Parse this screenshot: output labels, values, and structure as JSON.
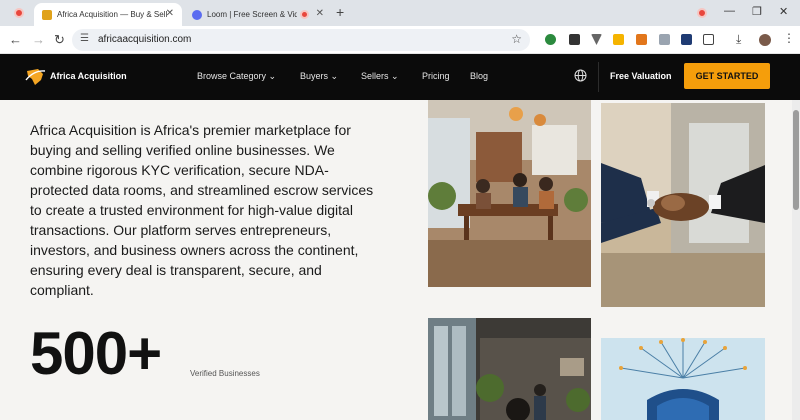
{
  "browser": {
    "tabs": [
      {
        "title": "Africa Acquisition — Buy & Sell",
        "active": true,
        "favicon_color": "#e0a21a"
      },
      {
        "title": "Loom | Free Screen & Video",
        "active": false,
        "favicon_color": "#5b6cf0"
      }
    ],
    "url": "africaacquisition.com",
    "icons": [
      "back-icon",
      "forward-icon",
      "reload-icon",
      "site-info-icon",
      "bookmark-star-icon",
      "download-icon",
      "profile-avatar",
      "menu-icon"
    ]
  },
  "site": {
    "brand": "Africa Acquisition",
    "nav": {
      "browse_category": "Browse Category",
      "buyers": "Buyers",
      "sellers": "Sellers",
      "pricing": "Pricing",
      "blog": "Blog",
      "free_valuation": "Free Valuation",
      "get_started": "GET STARTED"
    },
    "colors": {
      "accent": "#f59e0b",
      "nav_bg": "#0b0b0b"
    }
  },
  "hero": {
    "description": "Africa Acquisition is Africa's premier marketplace for buying and selling verified online businesses. We combine rigorous KYC verification, secure NDA-protected data rooms, and streamlined escrow services to create a trusted environment for high-value digital transactions. Our platform serves entrepreneurs, investors, and business owners across the continent, ensuring every deal is transparent, secure, and compliant.",
    "stat_number": "500+",
    "stat_label": "Verified Businesses"
  }
}
